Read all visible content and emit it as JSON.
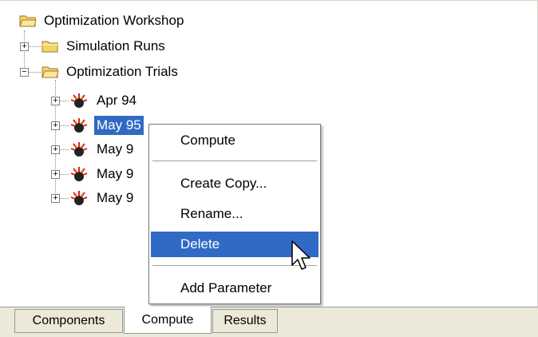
{
  "tree": {
    "root": "Optimization Workshop",
    "simulation_runs": "Simulation Runs",
    "optimization_trials": "Optimization Trials",
    "trials": [
      "Apr 94",
      "May 95",
      "May 9",
      "May 9",
      "May 9"
    ],
    "selected_index": 1
  },
  "context_menu": {
    "compute": "Compute",
    "create_copy": "Create Copy...",
    "rename": "Rename...",
    "delete": "Delete",
    "add_parameter": "Add Parameter"
  },
  "tabs": [
    "Components",
    "Compute",
    "Results"
  ],
  "active_tab": "Compute",
  "colors": {
    "selection": "#316ac5",
    "tab_bg": "#ece9d8",
    "folder": "#f5d36b"
  }
}
